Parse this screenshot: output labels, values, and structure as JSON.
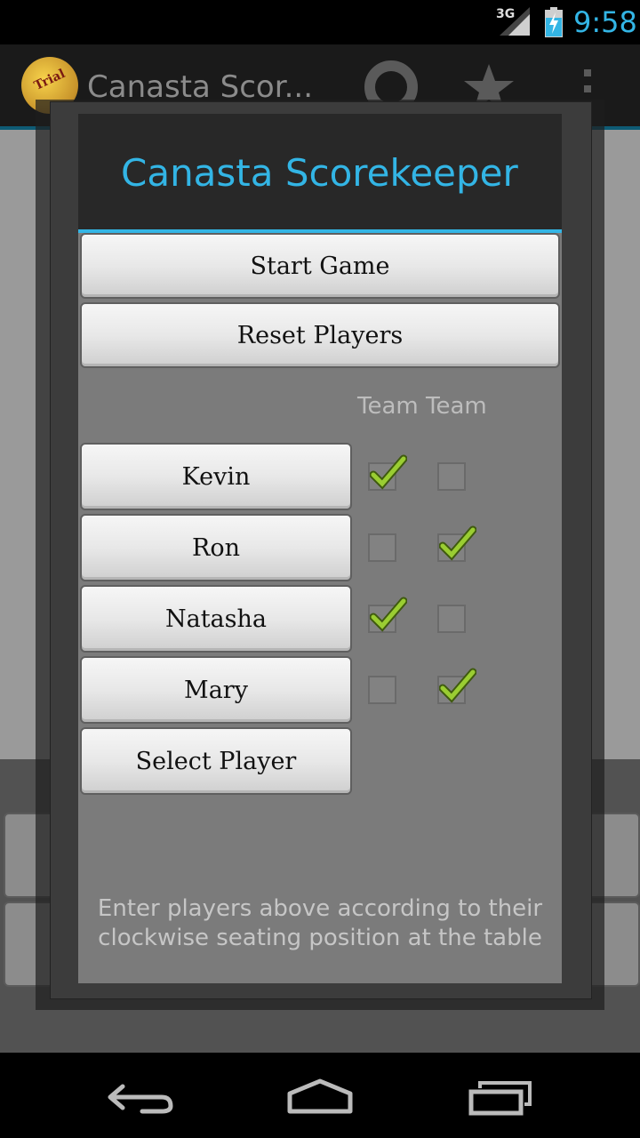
{
  "status_bar": {
    "network": "3G",
    "time": "9:58",
    "battery_icon": "battery-charging-icon",
    "signal_icon": "signal-icon"
  },
  "action_bar": {
    "logo_text": "Trial",
    "title": "Canasta Scor...",
    "icons": [
      "lifebuoy-icon",
      "star-icon",
      "overflow-menu-icon"
    ]
  },
  "dialog": {
    "title": "Canasta Scorekeeper",
    "start_game_label": "Start Game",
    "reset_players_label": "Reset Players",
    "team_header_1": "Team",
    "team_header_2": "Team",
    "players": [
      {
        "name": "Kevin",
        "team1": true,
        "team2": false
      },
      {
        "name": "Ron",
        "team1": false,
        "team2": true
      },
      {
        "name": "Natasha",
        "team1": true,
        "team2": false
      },
      {
        "name": "Mary",
        "team1": false,
        "team2": true
      }
    ],
    "select_player_label": "Select Player",
    "hint_line_1": "Enter players above according to their",
    "hint_line_2": "clockwise seating position at the table"
  },
  "nav_bar": {
    "icons": [
      "back-icon",
      "home-icon",
      "recent-apps-icon"
    ]
  },
  "colors": {
    "accent": "#33b5e5",
    "check_green": "#9acd32"
  }
}
